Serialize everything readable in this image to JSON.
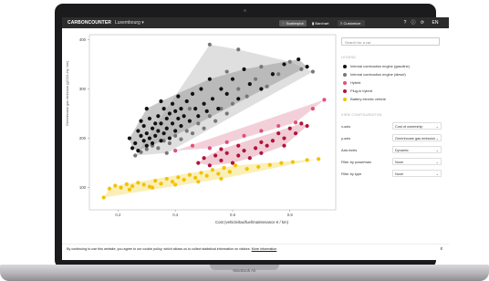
{
  "app": {
    "brand": "CARBONCOUNTER",
    "country": "Luxembourg",
    "country_chevron": "▾",
    "tabs": [
      {
        "label": "Scatterplot",
        "active": true,
        "icon": "scatter-icon"
      },
      {
        "label": "Barchart",
        "active": false,
        "icon": "bar-chart-icon"
      },
      {
        "label": "Customize",
        "active": false,
        "icon": "customize-icon"
      }
    ],
    "header_icons": [
      "help-icon",
      "info-icon",
      "share-icon"
    ],
    "language": "EN"
  },
  "panel": {
    "search_placeholder": "Search for a car",
    "legend_title": "LEGEND",
    "legend": [
      {
        "label": "Internal combustion engine (gasoline)",
        "color": "#111111"
      },
      {
        "label": "Internal combustion engine (diesel)",
        "color": "#777777"
      },
      {
        "label": "Hybrid",
        "color": "#e0507a"
      },
      {
        "label": "Plug-in hybrid",
        "color": "#b3123a"
      },
      {
        "label": "Battery electric vehicle",
        "color": "#f2c200"
      }
    ],
    "config_title": "VIEW CONFIGURATION",
    "config": [
      {
        "label": "x-axis",
        "value": "Cost of ownership"
      },
      {
        "label": "y-axis",
        "value": "Greenhouse gas emission"
      },
      {
        "label": "Axis limits",
        "value": "Dynamic"
      },
      {
        "label": "Filter by powertrain",
        "value": "None"
      },
      {
        "label": "Filter by type",
        "value": "None"
      }
    ]
  },
  "cookie": {
    "text": "By continuing to use this website, you agree to our cookie policy, which allows us to collect statistical information on visitors.",
    "link": "More information",
    "close": "x"
  },
  "device": {
    "model": "MacBook Air"
  },
  "chart_data": {
    "type": "scatter",
    "xlabel": "Cost (vehicle/tax/fuel/maintenance € / km)",
    "ylabel": "Greenhouse gas emission (gCO2-eq / km)",
    "xlim": [
      0.1,
      0.96
    ],
    "ylim": [
      55,
      410
    ],
    "xticks": [
      0.2,
      0.4,
      0.6,
      0.8
    ],
    "yticks": [
      100,
      200,
      300,
      400
    ],
    "grid": false,
    "series": [
      {
        "name": "Internal combustion engine (gasoline)",
        "color": "#111111",
        "hull_color": "#9a9a9a",
        "points": [
          [
            0.24,
            200
          ],
          [
            0.25,
            180
          ],
          [
            0.26,
            190
          ],
          [
            0.27,
            215
          ],
          [
            0.27,
            175
          ],
          [
            0.28,
            205
          ],
          [
            0.29,
            195
          ],
          [
            0.29,
            225
          ],
          [
            0.3,
            185
          ],
          [
            0.3,
            210
          ],
          [
            0.31,
            200
          ],
          [
            0.31,
            240
          ],
          [
            0.32,
            220
          ],
          [
            0.32,
            190
          ],
          [
            0.33,
            230
          ],
          [
            0.33,
            205
          ],
          [
            0.34,
            245
          ],
          [
            0.34,
            215
          ],
          [
            0.35,
            195
          ],
          [
            0.35,
            230
          ],
          [
            0.36,
            260
          ],
          [
            0.36,
            210
          ],
          [
            0.37,
            240
          ],
          [
            0.37,
            220
          ],
          [
            0.38,
            250
          ],
          [
            0.38,
            200
          ],
          [
            0.39,
            270
          ],
          [
            0.39,
            230
          ],
          [
            0.4,
            215
          ],
          [
            0.4,
            255
          ],
          [
            0.41,
            240
          ],
          [
            0.41,
            285
          ],
          [
            0.42,
            225
          ],
          [
            0.42,
            260
          ],
          [
            0.43,
            245
          ],
          [
            0.44,
            275
          ],
          [
            0.45,
            235
          ],
          [
            0.46,
            290
          ],
          [
            0.47,
            260
          ],
          [
            0.48,
            245
          ],
          [
            0.49,
            300
          ],
          [
            0.5,
            270
          ],
          [
            0.51,
            255
          ],
          [
            0.52,
            320
          ],
          [
            0.53,
            280
          ],
          [
            0.55,
            260
          ],
          [
            0.56,
            300
          ],
          [
            0.58,
            290
          ],
          [
            0.6,
            320
          ],
          [
            0.62,
            280
          ],
          [
            0.64,
            340
          ],
          [
            0.66,
            310
          ],
          [
            0.7,
            300
          ],
          [
            0.74,
            330
          ],
          [
            0.78,
            350
          ],
          [
            0.83,
            360
          ],
          [
            0.86,
            345
          ],
          [
            0.3,
            260
          ],
          [
            0.35,
            275
          ],
          [
            0.28,
            235
          ]
        ]
      },
      {
        "name": "Internal combustion engine (diesel)",
        "color": "#777777",
        "hull_color": "#c4c4c4",
        "points": [
          [
            0.26,
            165
          ],
          [
            0.28,
            172
          ],
          [
            0.3,
            178
          ],
          [
            0.32,
            185
          ],
          [
            0.34,
            180
          ],
          [
            0.36,
            195
          ],
          [
            0.38,
            190
          ],
          [
            0.4,
            205
          ],
          [
            0.42,
            198
          ],
          [
            0.44,
            215
          ],
          [
            0.46,
            210
          ],
          [
            0.48,
            230
          ],
          [
            0.5,
            220
          ],
          [
            0.52,
            245
          ],
          [
            0.54,
            235
          ],
          [
            0.56,
            260
          ],
          [
            0.58,
            250
          ],
          [
            0.6,
            270
          ],
          [
            0.62,
            300
          ],
          [
            0.65,
            285
          ],
          [
            0.68,
            320
          ],
          [
            0.72,
            305
          ],
          [
            0.76,
            330
          ],
          [
            0.8,
            355
          ],
          [
            0.84,
            340
          ],
          [
            0.88,
            335
          ],
          [
            0.52,
            390
          ],
          [
            0.62,
            380
          ],
          [
            0.58,
            335
          ],
          [
            0.7,
            345
          ],
          [
            0.45,
            260
          ],
          [
            0.37,
            170
          ]
        ]
      },
      {
        "name": "Hybrid",
        "color": "#e0507a",
        "hull_color": "#e9aab9",
        "points": [
          [
            0.4,
            175
          ],
          [
            0.46,
            185
          ],
          [
            0.52,
            180
          ],
          [
            0.58,
            192
          ],
          [
            0.64,
            205
          ],
          [
            0.7,
            215
          ],
          [
            0.76,
            225
          ],
          [
            0.82,
            232
          ],
          [
            0.88,
            260
          ],
          [
            0.92,
            278
          ]
        ]
      },
      {
        "name": "Plug-in hybrid",
        "color": "#b3123a",
        "hull_color": "#e3a3b2",
        "points": [
          [
            0.48,
            150
          ],
          [
            0.5,
            160
          ],
          [
            0.52,
            145
          ],
          [
            0.54,
            165
          ],
          [
            0.56,
            155
          ],
          [
            0.58,
            170
          ],
          [
            0.6,
            150
          ],
          [
            0.62,
            165
          ],
          [
            0.64,
            175
          ],
          [
            0.66,
            160
          ],
          [
            0.68,
            180
          ],
          [
            0.7,
            170
          ],
          [
            0.72,
            185
          ],
          [
            0.74,
            195
          ],
          [
            0.76,
            210
          ],
          [
            0.78,
            200
          ],
          [
            0.8,
            220
          ],
          [
            0.82,
            210
          ],
          [
            0.84,
            230
          ],
          [
            0.86,
            225
          ],
          [
            0.56,
            178
          ],
          [
            0.62,
            185
          ],
          [
            0.7,
            192
          ],
          [
            0.78,
            185
          ]
        ]
      },
      {
        "name": "Battery electric vehicle",
        "color": "#f2c200",
        "hull_color": "#f5e27a",
        "points": [
          [
            0.15,
            80
          ],
          [
            0.17,
            98
          ],
          [
            0.19,
            104
          ],
          [
            0.21,
            100
          ],
          [
            0.23,
            107
          ],
          [
            0.25,
            103
          ],
          [
            0.27,
            110
          ],
          [
            0.29,
            106
          ],
          [
            0.31,
            102
          ],
          [
            0.33,
            114
          ],
          [
            0.35,
            108
          ],
          [
            0.37,
            118
          ],
          [
            0.39,
            112
          ],
          [
            0.41,
            121
          ],
          [
            0.43,
            116
          ],
          [
            0.45,
            126
          ],
          [
            0.47,
            120
          ],
          [
            0.49,
            130
          ],
          [
            0.51,
            124
          ],
          [
            0.53,
            136
          ],
          [
            0.55,
            128
          ],
          [
            0.57,
            140
          ],
          [
            0.59,
            132
          ],
          [
            0.61,
            145
          ],
          [
            0.65,
            138
          ],
          [
            0.69,
            142
          ],
          [
            0.73,
            146
          ],
          [
            0.77,
            150
          ],
          [
            0.81,
            152
          ],
          [
            0.86,
            156
          ],
          [
            0.9,
            158
          ],
          [
            0.24,
            96
          ],
          [
            0.32,
            100
          ],
          [
            0.4,
            106
          ],
          [
            0.48,
            112
          ],
          [
            0.56,
            118
          ]
        ]
      }
    ]
  }
}
